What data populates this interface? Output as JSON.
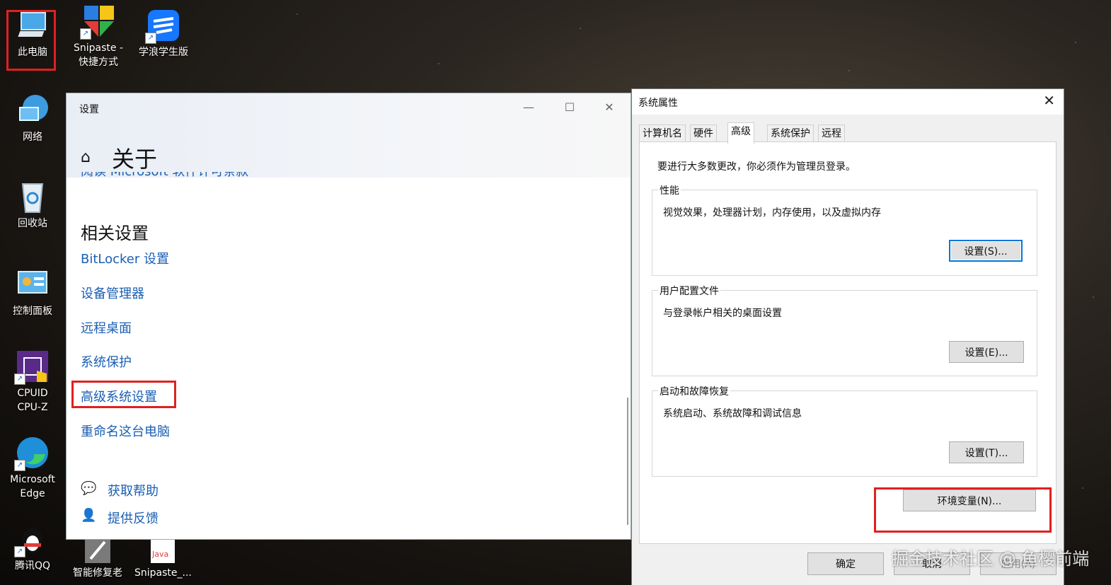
{
  "desktop": {
    "icons": [
      {
        "label": "此电脑"
      },
      {
        "label": "Snipaste - 快捷方式"
      },
      {
        "label": "学浪学生版"
      },
      {
        "label": "网络"
      },
      {
        "label": "回收站"
      },
      {
        "label": "控制面板"
      },
      {
        "label": "CPUID CPU-Z"
      },
      {
        "label": "Microsoft Edge"
      },
      {
        "label": "腾讯QQ"
      },
      {
        "label": "智能修复老"
      },
      {
        "label": "Snipaste_..."
      }
    ],
    "java_badge": "Java"
  },
  "settings": {
    "app_title": "设置",
    "page_title": "关于",
    "partial_link": "阅读 Microsoft 软件许可条款",
    "section_title": "相关设置",
    "links": [
      "BitLocker 设置",
      "设备管理器",
      "远程桌面",
      "系统保护",
      "高级系统设置",
      "重命名这台电脑"
    ],
    "help": "获取帮助",
    "feedback": "提供反馈"
  },
  "system_properties": {
    "title": "系统属性",
    "tabs": [
      "计算机名",
      "硬件",
      "高级",
      "系统保护",
      "远程"
    ],
    "active_tab": "高级",
    "admin_note": "要进行大多数更改，你必须作为管理员登录。",
    "groups": [
      {
        "label": "性能",
        "desc": "视觉效果，处理器计划，内存使用，以及虚拟内存",
        "button": "设置(S)..."
      },
      {
        "label": "用户配置文件",
        "desc": "与登录帐户相关的桌面设置",
        "button": "设置(E)..."
      },
      {
        "label": "启动和故障恢复",
        "desc": "系统启动、系统故障和调试信息",
        "button": "设置(T)..."
      }
    ],
    "env_button": "环境变量(N)...",
    "ok": "确定",
    "cancel": "取消",
    "apply": "应用(A)"
  },
  "watermark": "掘金技术社区 @ 鱼樱前端",
  "colors": {
    "link": "#1a5fb4",
    "highlight": "#e02020",
    "focus": "#0078d7"
  }
}
